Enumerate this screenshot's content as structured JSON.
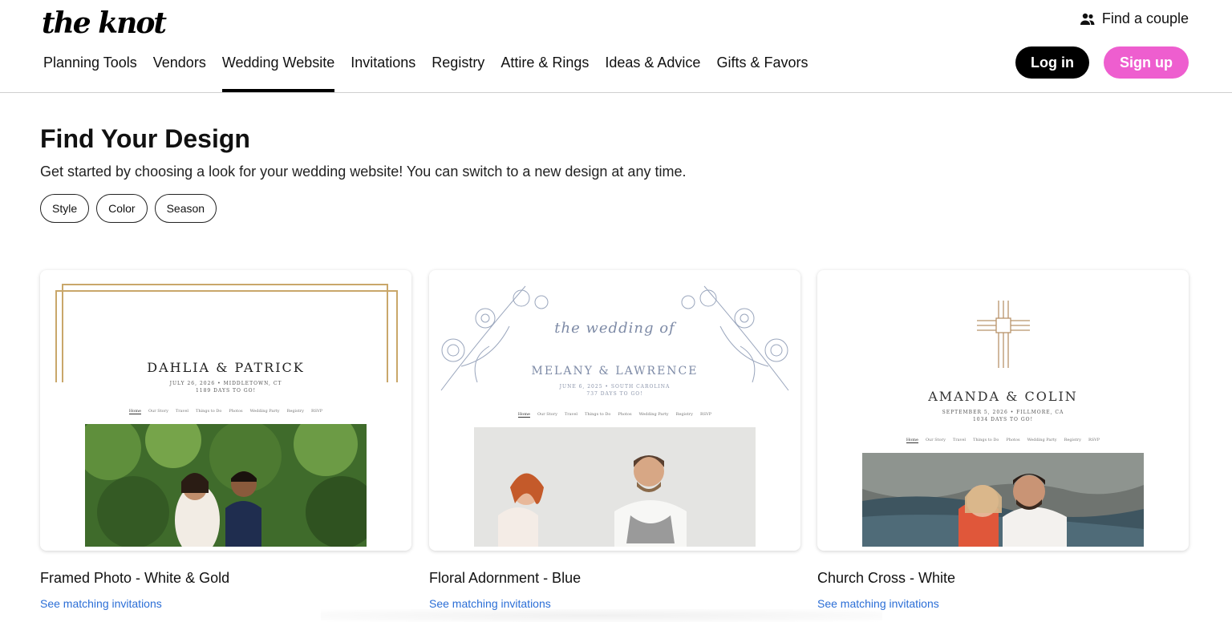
{
  "header": {
    "logo": "the knot",
    "find_couple": "Find a couple",
    "nav": [
      "Planning Tools",
      "Vendors",
      "Wedding Website",
      "Invitations",
      "Registry",
      "Attire & Rings",
      "Ideas & Advice",
      "Gifts & Favors"
    ],
    "active_nav": "Wedding Website",
    "login": "Log in",
    "signup": "Sign up"
  },
  "main": {
    "title": "Find Your Design",
    "subtitle": "Get started by choosing a look for your wedding website! You can switch to a new design at any time.",
    "filters": [
      "Style",
      "Color",
      "Season"
    ]
  },
  "cards": [
    {
      "name": "Framed Photo - White & Gold",
      "link": "See matching invitations",
      "couple": "DAHLIA & PATRICK",
      "date_line": "JULY 26, 2026 • MIDDLETOWN, CT",
      "countdown": "1189 DAYS TO GO!",
      "nav": [
        "Home",
        "Our Story",
        "Travel",
        "Things to Do",
        "Photos",
        "Wedding Party",
        "Registry",
        "RSVP"
      ]
    },
    {
      "name": "Floral Adornment - Blue",
      "link": "See matching invitations",
      "script": "the wedding of",
      "couple": "MELANY & LAWRENCE",
      "date_line": "JUNE 6, 2025 • SOUTH CAROLINA",
      "countdown": "737 DAYS TO GO!",
      "nav": [
        "Home",
        "Our Story",
        "Travel",
        "Things to Do",
        "Photos",
        "Wedding Party",
        "Registry",
        "RSVP"
      ]
    },
    {
      "name": "Church Cross - White",
      "link": "See matching invitations",
      "couple": "AMANDA & COLIN",
      "date_line": "SEPTEMBER 5, 2026 • FILLMORE, CA",
      "countdown": "1034 DAYS TO GO!",
      "nav": [
        "Home",
        "Our Story",
        "Travel",
        "Things to Do",
        "Photos",
        "Wedding Party",
        "Registry",
        "RSVP"
      ]
    }
  ],
  "colors": {
    "signup": "#ee5ecf",
    "link": "#2b6ed6",
    "gold": "#c9a76a",
    "floral_blue": "#7d8aa6"
  }
}
